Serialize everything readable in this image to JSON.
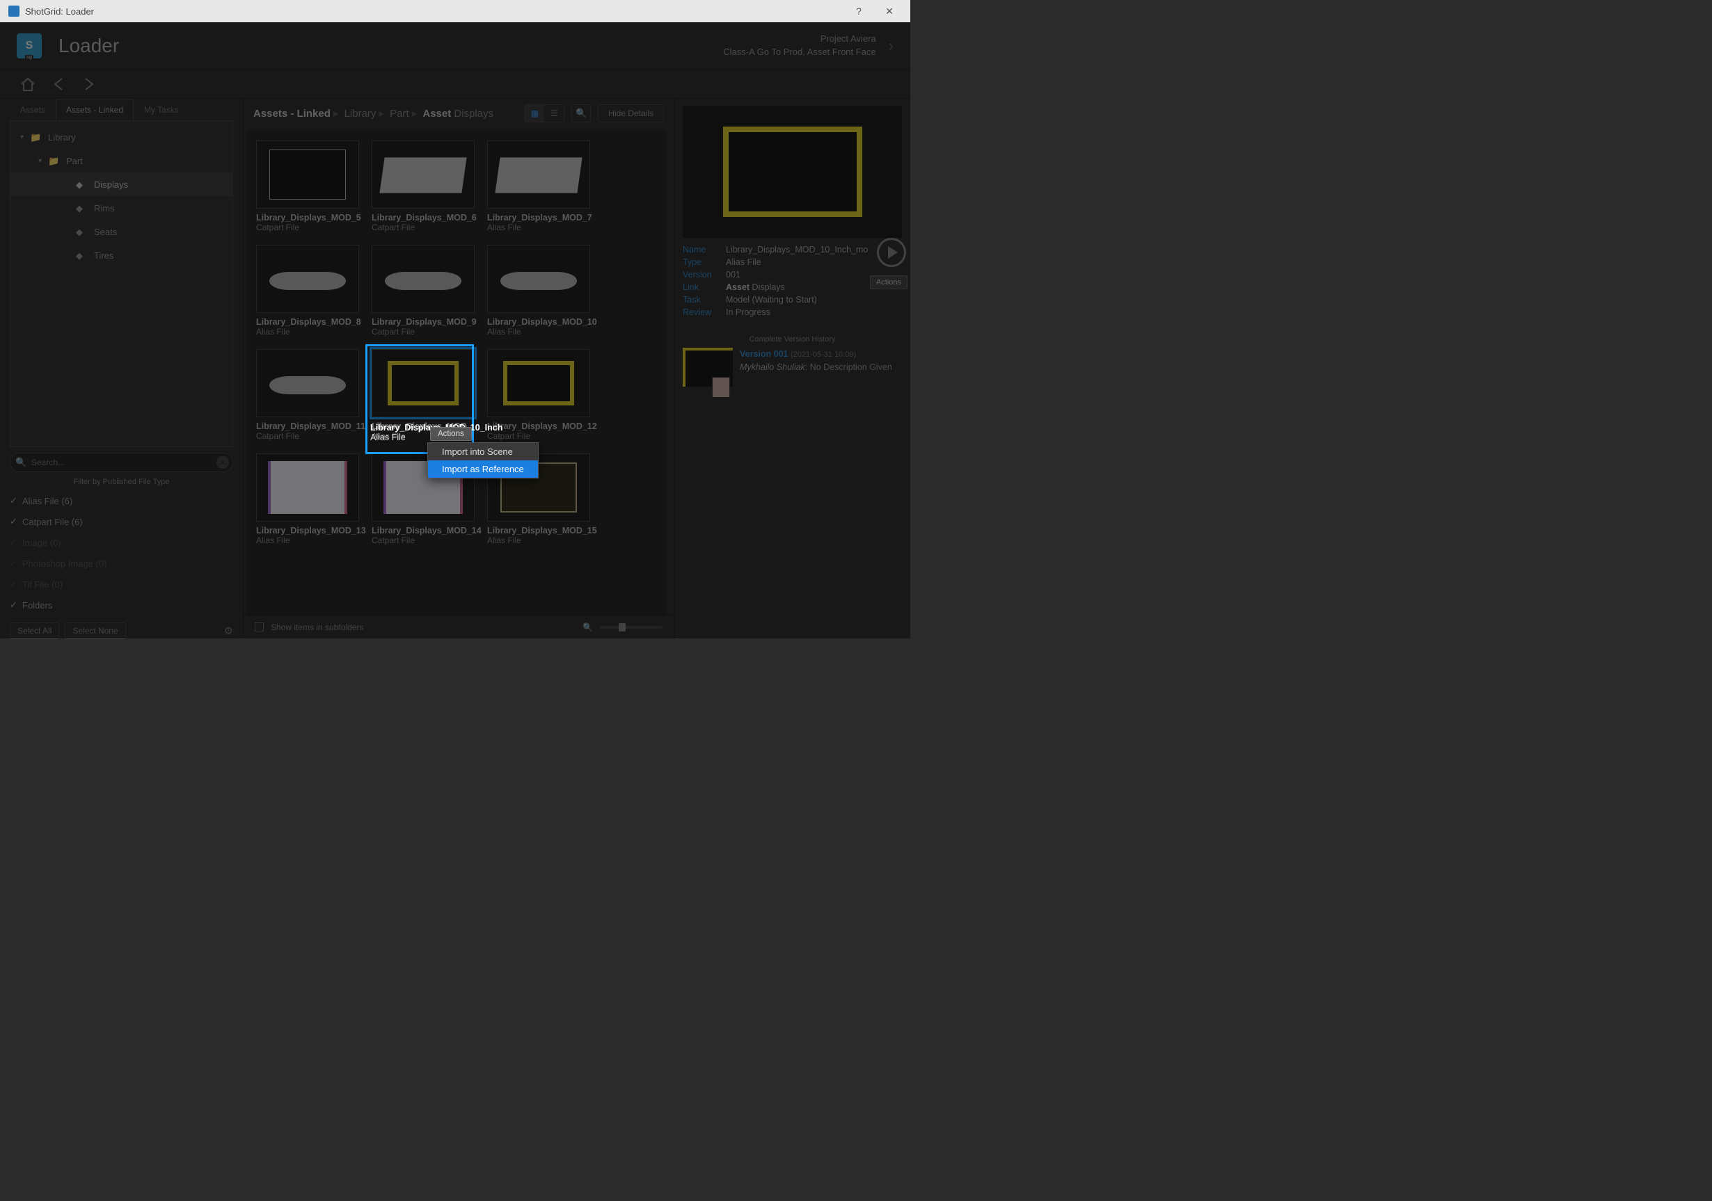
{
  "window": {
    "title": "ShotGrid: Loader"
  },
  "header": {
    "app_title": "Loader",
    "project_line1": "Project Aviera",
    "project_line2": "Class-A Go To Prod, Asset Front Face"
  },
  "tabs": [
    "Assets",
    "Assets - Linked",
    "My Tasks"
  ],
  "active_tab": 1,
  "tree": {
    "items": [
      {
        "label": "Library",
        "depth": 0,
        "expanded": true,
        "icon": "folder"
      },
      {
        "label": "Part",
        "depth": 1,
        "expanded": true,
        "icon": "folder"
      },
      {
        "label": "Displays",
        "depth": 2,
        "icon": "node",
        "selected": true
      },
      {
        "label": "Rims",
        "depth": 2,
        "icon": "node"
      },
      {
        "label": "Seats",
        "depth": 2,
        "icon": "node"
      },
      {
        "label": "Tires",
        "depth": 2,
        "icon": "node"
      }
    ]
  },
  "search": {
    "placeholder": "Search..."
  },
  "filter": {
    "heading": "Filter by Published File Type",
    "rows": [
      {
        "label": "Alias File (6)",
        "on": true
      },
      {
        "label": "Catpart File (6)",
        "on": true
      },
      {
        "label": "Image (0)",
        "on": false
      },
      {
        "label": "Photoshop Image (0)",
        "on": false
      },
      {
        "label": "Tif File (0)",
        "on": false
      },
      {
        "label": "Folders",
        "on": true
      }
    ],
    "select_all": "Select All",
    "select_none": "Select None"
  },
  "breadcrumb": {
    "root": "Assets - Linked",
    "p1": "Library",
    "p2": "Part",
    "p3a": "Asset",
    "p3b": "Displays"
  },
  "toolbar": {
    "hide_details": "Hide Details"
  },
  "cards": [
    {
      "title": "Library_Displays_MOD_5",
      "sub": "Catpart File",
      "art": "screen"
    },
    {
      "title": "Library_Displays_MOD_6",
      "sub": "Catpart File",
      "art": "slab"
    },
    {
      "title": "Library_Displays_MOD_7",
      "sub": "Alias File",
      "art": "slab"
    },
    {
      "title": "Library_Displays_MOD_8",
      "sub": "Alias File",
      "art": "bar"
    },
    {
      "title": "Library_Displays_MOD_9",
      "sub": "Catpart File",
      "art": "bar"
    },
    {
      "title": "Library_Displays_MOD_10",
      "sub": "Alias File",
      "art": "bar"
    },
    {
      "title": "Library_Displays_MOD_11",
      "sub": "Catpart File",
      "art": "bar"
    },
    {
      "title": "Library_Displays_MOD_10_Inch",
      "sub": "Alias File",
      "art": "yell",
      "selected": true
    },
    {
      "title": "Library_Displays_MOD_12",
      "sub": "Catpart File",
      "art": "yell"
    },
    {
      "title": "Library_Displays_MOD_13",
      "sub": "Alias File",
      "art": "white"
    },
    {
      "title": "Library_Displays_MOD_14",
      "sub": "Catpart File",
      "art": "white"
    },
    {
      "title": "Library_Displays_MOD_15",
      "sub": "Alias File",
      "art": "dark"
    }
  ],
  "actions_label": "Actions",
  "popup": {
    "items": [
      {
        "label": "Import into Scene",
        "hl": false
      },
      {
        "label": "Import as Reference",
        "hl": true
      }
    ]
  },
  "footer": {
    "checkbox_label": "Show items in subfolders"
  },
  "detail": {
    "fields": {
      "Name": "Library_Displays_MOD_10_Inch_mo",
      "Type": "Alias File",
      "Version": "001",
      "LinkA": "Asset",
      "LinkB": "Displays",
      "Task": "Model (Waiting to Start)",
      "Review": "In Progress"
    },
    "actions_label": "Actions",
    "history_heading": "Complete Version History",
    "version": {
      "name": "Version 001",
      "date": "(2021-05-31 10:09)",
      "author": "Mykhailo Shuliak",
      "desc": "No Description Given"
    }
  }
}
